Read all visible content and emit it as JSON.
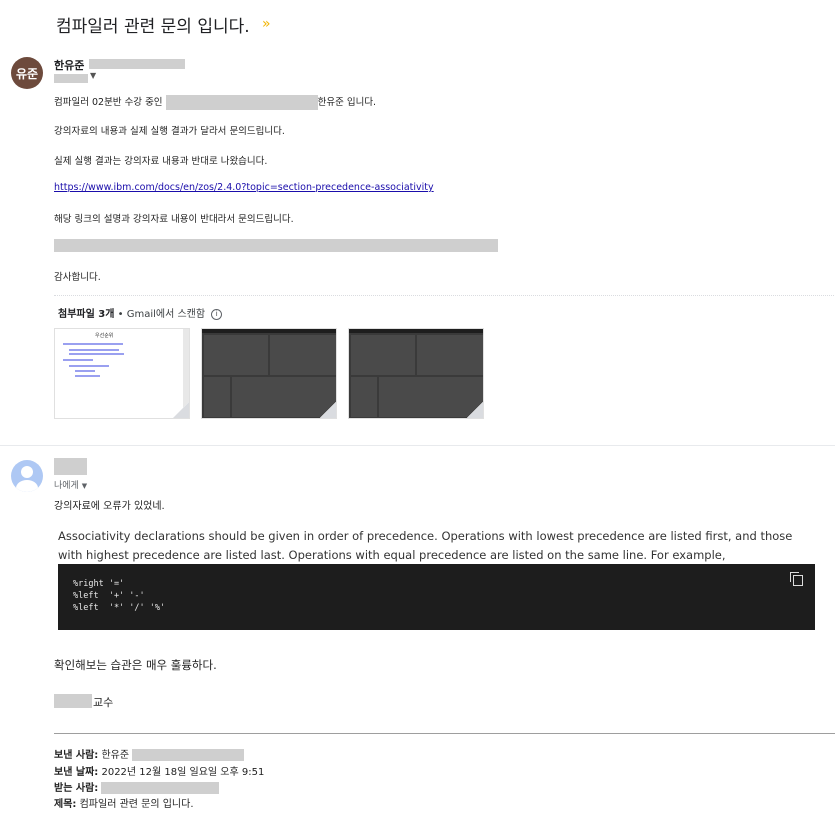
{
  "thread": {
    "subject": "컴파일러 관련 문의 입니다.",
    "important_icon": "importance-marker-icon"
  },
  "message1": {
    "avatar_initials": "유준",
    "sender_name": "한유준",
    "body": {
      "line1_prefix": "컴파일러 02분반 수강 중인",
      "line1_suffix": "한유준 입니다.",
      "line2": "강의자료의 내용과 실제 실행 결과가 달라서 문의드립니다.",
      "line3": "실제 실행 결과는 강의자료 내용과 반대로 나왔습니다.",
      "link": "https://www.ibm.com/docs/en/zos/2.4.0?topic=section-precedence-associativity",
      "line4": "해당 링크의 설명과 강의자료 내용이 반대라서 문의드립니다.",
      "closing": "감사합니다."
    },
    "attachments": {
      "count_label": "첨부파일 3개",
      "scan_label": "Gmail에서 스캔함",
      "items": [
        {
          "title": "우선순위"
        },
        {
          "title": ""
        },
        {
          "title": ""
        }
      ]
    }
  },
  "message2": {
    "recipient_label": "나에게",
    "reply_line": "강의자료에 오류가 있었네.",
    "quote_text": "Associativity declarations should be given in order of precedence. Operations with lowest precedence are listed first, and those with highest precedence are listed last. Operations with equal precedence are listed on the same line. For example,",
    "code": "%right '='\n%left  '+' '-'\n%left  '*' '/' '%'",
    "remark": "확인해보는 습관은 매우 훌륭하다.",
    "signature_title": "교수"
  },
  "forwarded": {
    "from_label": "보낸 사람:",
    "from_value": "한유준",
    "date_label": "보낸 날짜:",
    "date_value": "2022년 12월 18일 일요일 오후 9:51",
    "to_label": "받는 사람:",
    "subject_label": "제목:",
    "subject_value": "컴파일러 관련 문의 입니다."
  }
}
